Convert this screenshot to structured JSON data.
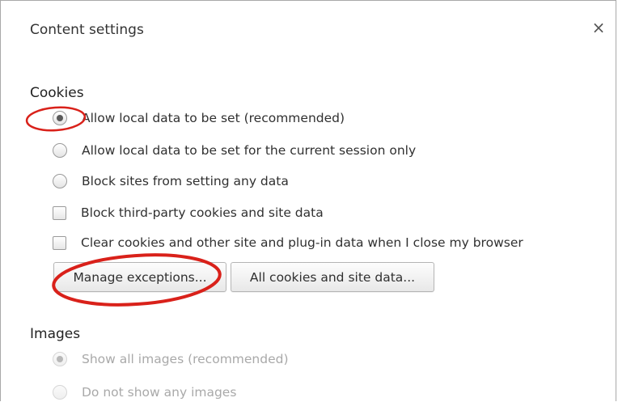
{
  "dialog": {
    "title": "Content settings",
    "close_glyph": "×"
  },
  "cookies": {
    "heading": "Cookies",
    "radios": [
      {
        "label": "Allow local data to be set (recommended)",
        "checked": true
      },
      {
        "label": "Allow local data to be set for the current session only",
        "checked": false
      },
      {
        "label": "Block sites from setting any data",
        "checked": false
      }
    ],
    "checkboxes": [
      {
        "label": "Block third-party cookies and site data",
        "checked": false
      },
      {
        "label": "Clear cookies and other site and plug-in data when I close my browser",
        "checked": false
      }
    ],
    "buttons": {
      "manage_exceptions": "Manage exceptions...",
      "all_cookies": "All cookies and site data..."
    }
  },
  "images": {
    "heading": "Images",
    "radios": [
      {
        "label": "Show all images (recommended)",
        "checked": true
      },
      {
        "label": "Do not show any images",
        "checked": false
      }
    ]
  },
  "icons": {
    "close": "close-icon"
  },
  "colors": {
    "annotation": "#d9211a",
    "disabled_text": "#a9a9a9"
  }
}
